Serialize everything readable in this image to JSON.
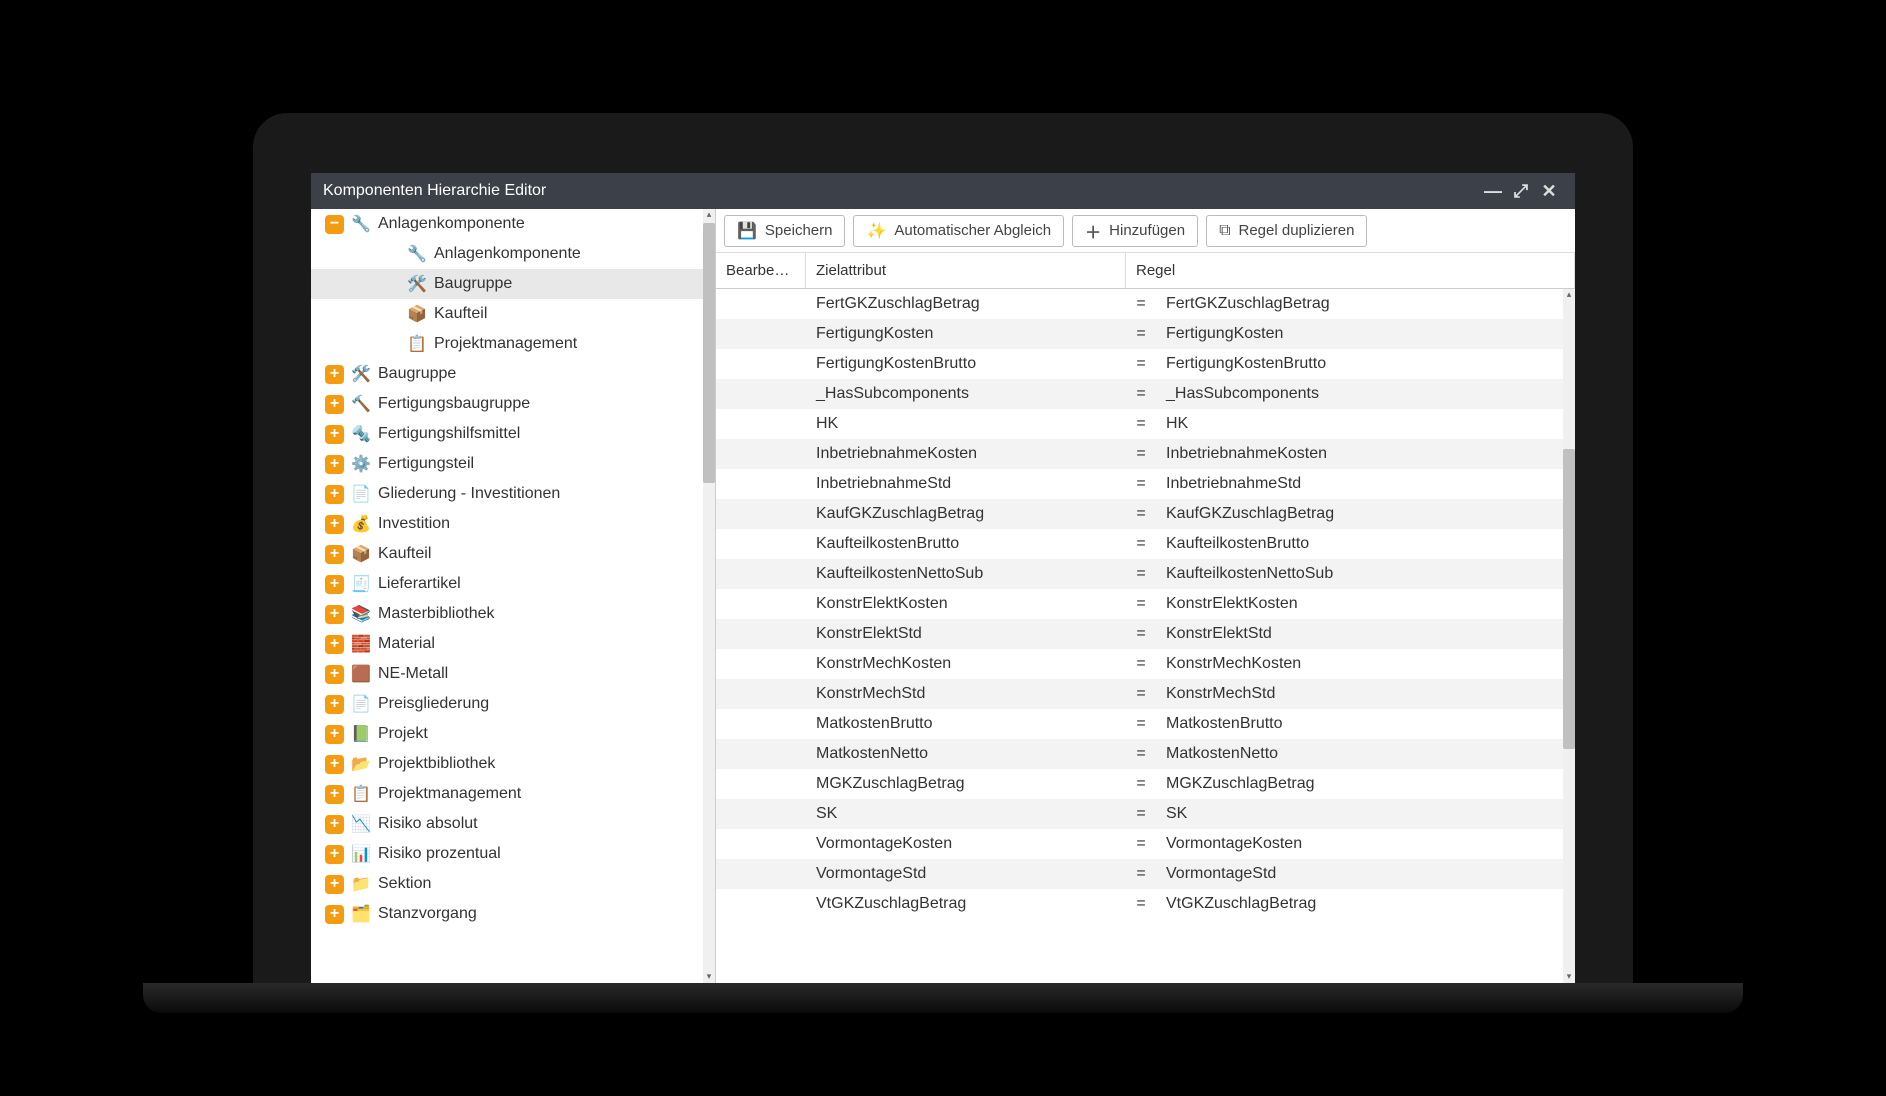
{
  "window": {
    "title": "Komponenten Hierarchie Editor"
  },
  "toolbar": {
    "save": "Speichern",
    "auto_match": "Automatischer Abgleich",
    "add": "Hinzufügen",
    "duplicate": "Regel duplizieren"
  },
  "table": {
    "columns": {
      "edit": "Bearbe…",
      "target": "Zielattribut",
      "rule": "Regel"
    },
    "rows": [
      {
        "target": "FertGKZuschlagBetrag",
        "rule": "FertGKZuschlagBetrag"
      },
      {
        "target": "FertigungKosten",
        "rule": "FertigungKosten"
      },
      {
        "target": "FertigungKostenBrutto",
        "rule": "FertigungKostenBrutto"
      },
      {
        "target": "_HasSubcomponents",
        "rule": "_HasSubcomponents"
      },
      {
        "target": "HK",
        "rule": "HK"
      },
      {
        "target": "InbetriebnahmeKosten",
        "rule": "InbetriebnahmeKosten"
      },
      {
        "target": "InbetriebnahmeStd",
        "rule": "InbetriebnahmeStd"
      },
      {
        "target": "KaufGKZuschlagBetrag",
        "rule": "KaufGKZuschlagBetrag"
      },
      {
        "target": "KaufteilkostenBrutto",
        "rule": "KaufteilkostenBrutto"
      },
      {
        "target": "KaufteilkostenNettoSub",
        "rule": "KaufteilkostenNettoSub"
      },
      {
        "target": "KonstrElektKosten",
        "rule": "KonstrElektKosten"
      },
      {
        "target": "KonstrElektStd",
        "rule": "KonstrElektStd"
      },
      {
        "target": "KonstrMechKosten",
        "rule": "KonstrMechKosten"
      },
      {
        "target": "KonstrMechStd",
        "rule": "KonstrMechStd"
      },
      {
        "target": "MatkostenBrutto",
        "rule": "MatkostenBrutto"
      },
      {
        "target": "MatkostenNetto",
        "rule": "MatkostenNetto"
      },
      {
        "target": "MGKZuschlagBetrag",
        "rule": "MGKZuschlagBetrag"
      },
      {
        "target": "SK",
        "rule": "SK"
      },
      {
        "target": "VormontageKosten",
        "rule": "VormontageKosten"
      },
      {
        "target": "VormontageStd",
        "rule": "VormontageStd"
      },
      {
        "target": "VtGKZuschlagBetrag",
        "rule": "VtGKZuschlagBetrag"
      }
    ]
  },
  "tree": {
    "items": [
      {
        "level": 0,
        "expander": "−",
        "icon": "🔧",
        "label": "Anlagenkomponente",
        "selected": false
      },
      {
        "level": 1,
        "expander": "",
        "icon": "🔧",
        "label": "Anlagenkomponente",
        "selected": false
      },
      {
        "level": 1,
        "expander": "",
        "icon": "🛠️",
        "label": "Baugruppe",
        "selected": true
      },
      {
        "level": 1,
        "expander": "",
        "icon": "📦",
        "label": "Kaufteil",
        "selected": false
      },
      {
        "level": 1,
        "expander": "",
        "icon": "📋",
        "label": "Projektmanagement",
        "selected": false
      },
      {
        "level": 0,
        "expander": "+",
        "icon": "🛠️",
        "label": "Baugruppe",
        "selected": false
      },
      {
        "level": 0,
        "expander": "+",
        "icon": "🔨",
        "label": "Fertigungsbaugruppe",
        "selected": false
      },
      {
        "level": 0,
        "expander": "+",
        "icon": "🔩",
        "label": "Fertigungshilfsmittel",
        "selected": false
      },
      {
        "level": 0,
        "expander": "+",
        "icon": "⚙️",
        "label": "Fertigungsteil",
        "selected": false
      },
      {
        "level": 0,
        "expander": "+",
        "icon": "📄",
        "label": "Gliederung - Investitionen",
        "selected": false
      },
      {
        "level": 0,
        "expander": "+",
        "icon": "💰",
        "label": "Investition",
        "selected": false
      },
      {
        "level": 0,
        "expander": "+",
        "icon": "📦",
        "label": "Kaufteil",
        "selected": false
      },
      {
        "level": 0,
        "expander": "+",
        "icon": "🧾",
        "label": "Lieferartikel",
        "selected": false
      },
      {
        "level": 0,
        "expander": "+",
        "icon": "📚",
        "label": "Masterbibliothek",
        "selected": false
      },
      {
        "level": 0,
        "expander": "+",
        "icon": "🧱",
        "label": "Material",
        "selected": false
      },
      {
        "level": 0,
        "expander": "+",
        "icon": "🟫",
        "label": "NE-Metall",
        "selected": false
      },
      {
        "level": 0,
        "expander": "+",
        "icon": "📄",
        "label": "Preisgliederung",
        "selected": false
      },
      {
        "level": 0,
        "expander": "+",
        "icon": "📗",
        "label": "Projekt",
        "selected": false
      },
      {
        "level": 0,
        "expander": "+",
        "icon": "📂",
        "label": "Projektbibliothek",
        "selected": false
      },
      {
        "level": 0,
        "expander": "+",
        "icon": "📋",
        "label": "Projektmanagement",
        "selected": false
      },
      {
        "level": 0,
        "expander": "+",
        "icon": "📉",
        "label": "Risiko absolut",
        "selected": false
      },
      {
        "level": 0,
        "expander": "+",
        "icon": "📊",
        "label": "Risiko prozentual",
        "selected": false
      },
      {
        "level": 0,
        "expander": "+",
        "icon": "📁",
        "label": "Sektion",
        "selected": false
      },
      {
        "level": 0,
        "expander": "+",
        "icon": "🗂️",
        "label": "Stanzvorgang",
        "selected": false
      }
    ]
  }
}
